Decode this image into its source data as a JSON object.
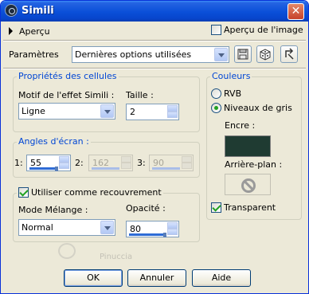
{
  "window": {
    "title": "Simili"
  },
  "preview": {
    "label": "Aperçu",
    "image_preview_label": "Aperçu de l'image",
    "image_preview_checked": false
  },
  "params": {
    "label": "Paramètres",
    "preset_value": "Dernières options utilisées"
  },
  "cell_props": {
    "legend": "Propriétés des cellules",
    "pattern_label": "Motif de l'effet Simili :",
    "pattern_value": "Ligne",
    "size_label": "Taille :",
    "size_value": "2"
  },
  "screen_angles": {
    "legend": "Angles d'écran :",
    "a1_label": "1:",
    "a1_value": "55",
    "a2_label": "2:",
    "a2_value": "162",
    "a3_label": "3:",
    "a3_value": "90"
  },
  "overlay": {
    "use_label": "Utiliser comme recouvrement",
    "use_checked": true,
    "blend_label": "Mode Mélange :",
    "blend_value": "Normal",
    "opacity_label": "Opacité :",
    "opacity_value": "80"
  },
  "colors": {
    "legend": "Couleurs",
    "rgb_label": "RVB",
    "gray_label": "Niveaux de gris",
    "selected": "gray",
    "ink_label": "Encre :",
    "ink_color": "#1F3B32",
    "background_label": "Arrière-plan :",
    "transparent_label": "Transparent",
    "transparent_checked": true
  },
  "buttons": {
    "ok": "OK",
    "cancel": "Annuler",
    "help": "Aide"
  },
  "watermark": {
    "text": "Pinuccia"
  }
}
